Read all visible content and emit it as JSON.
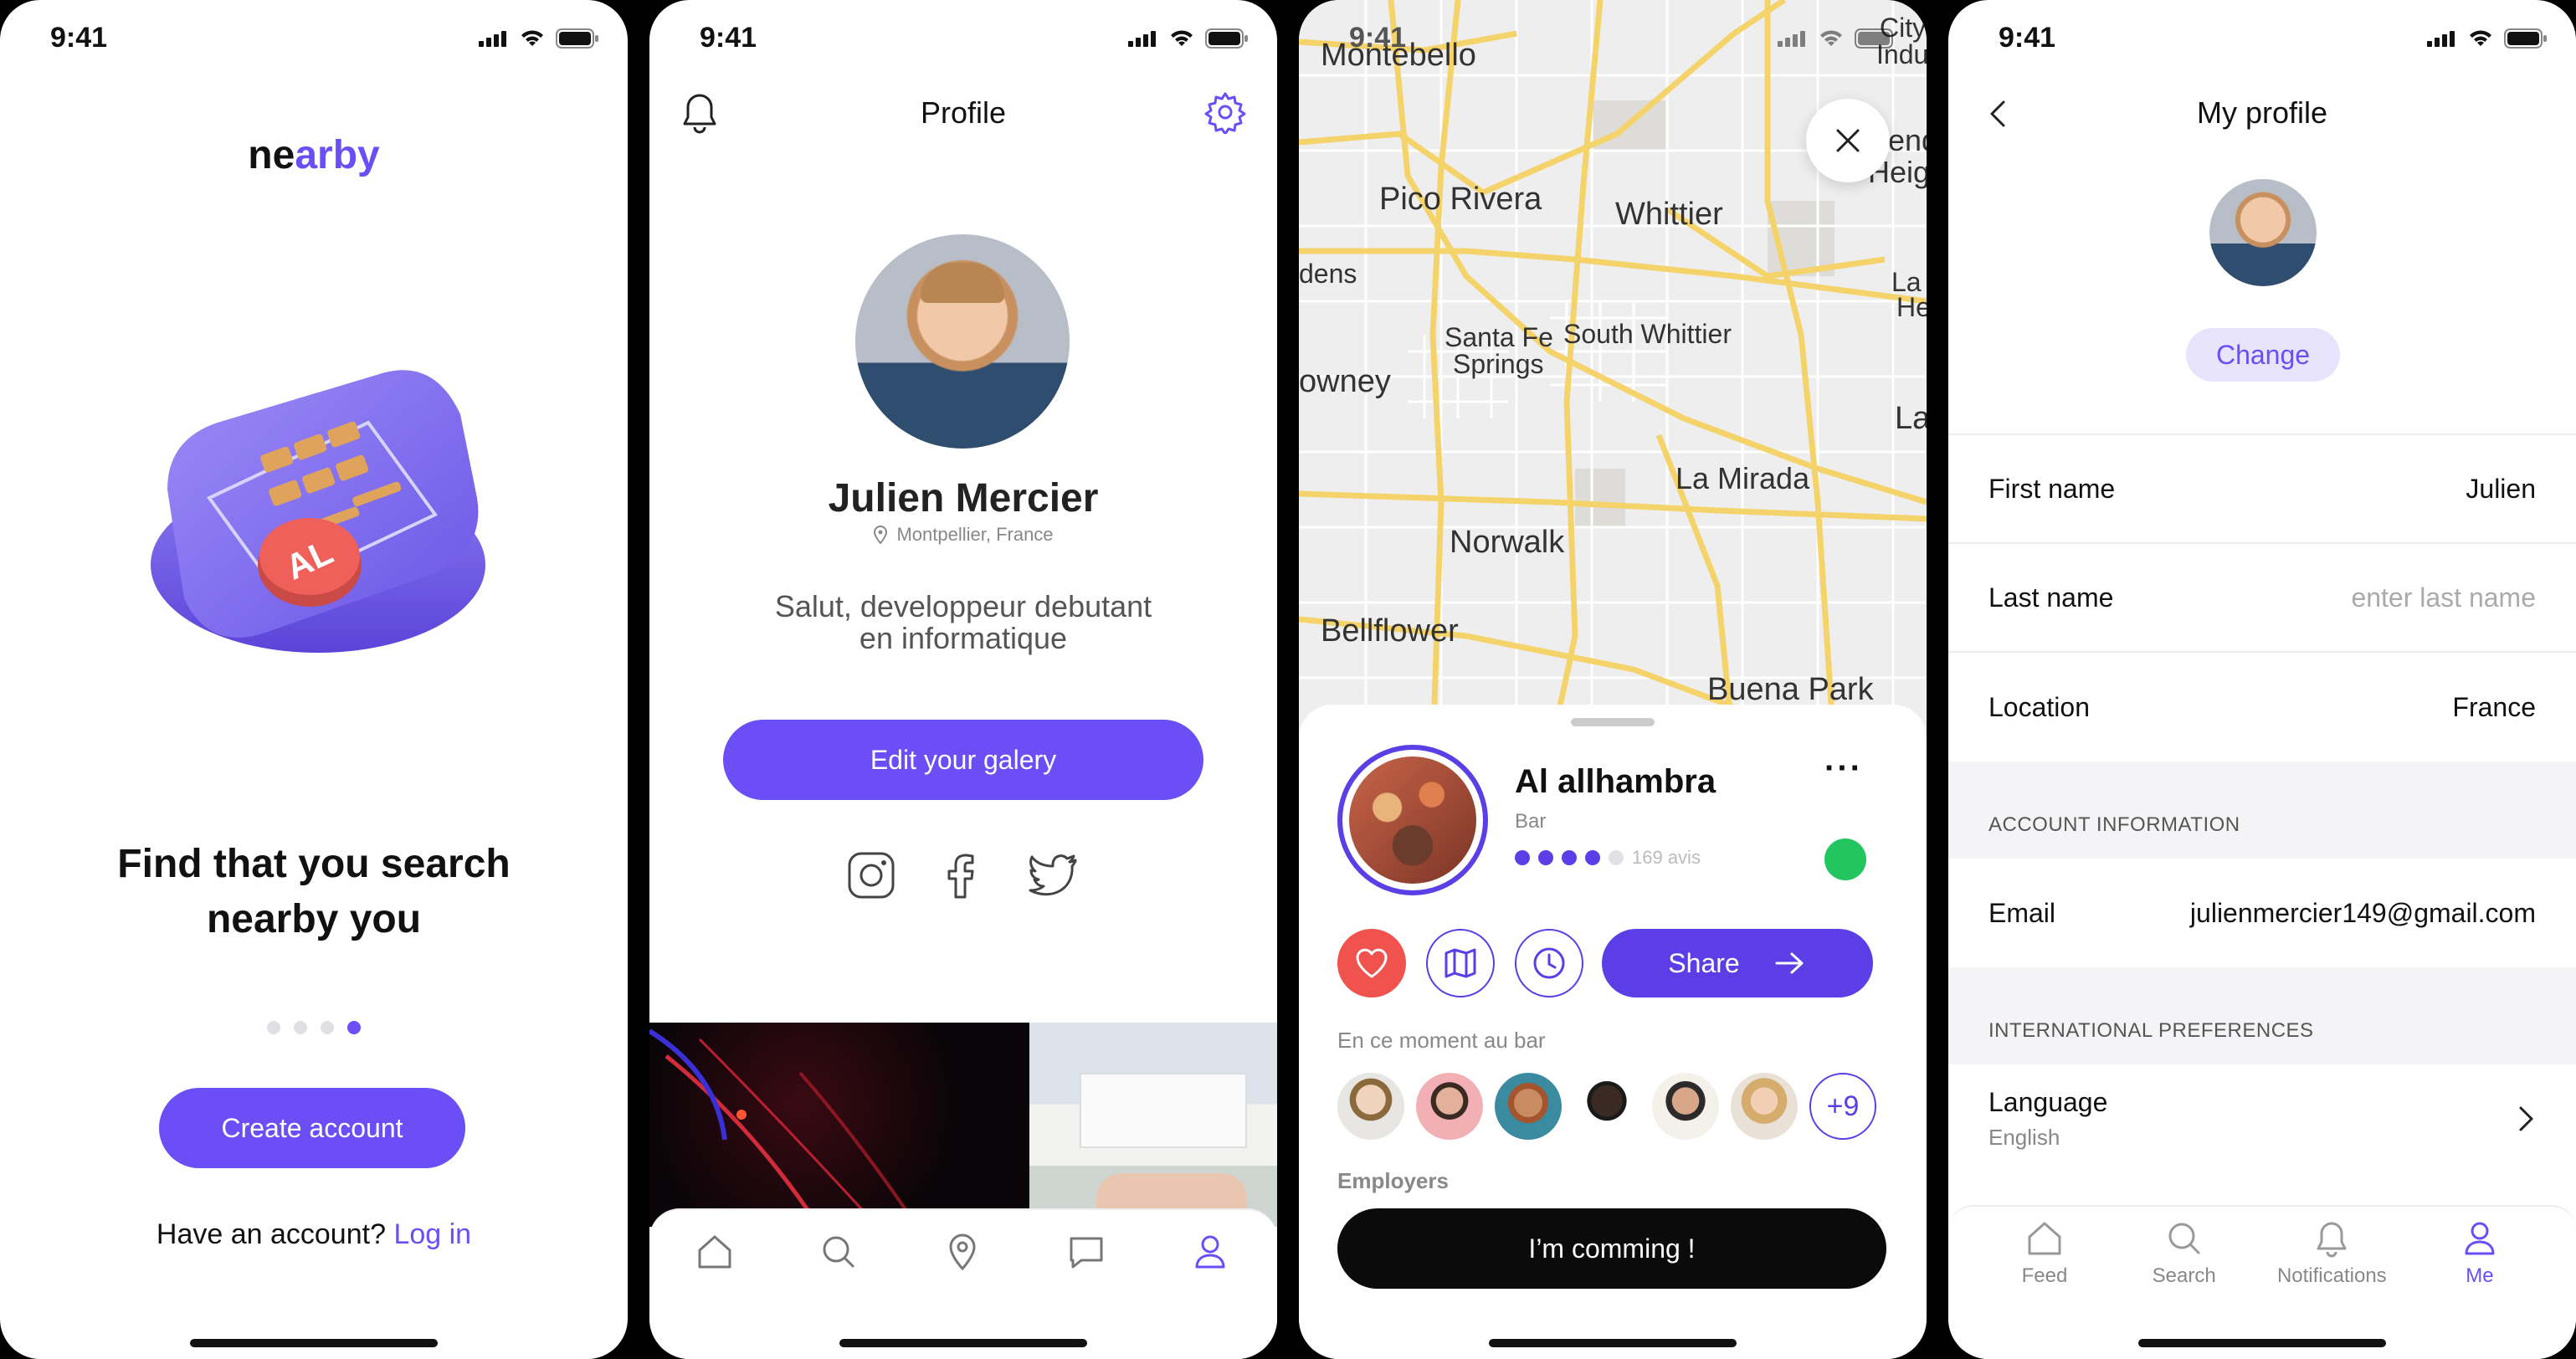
{
  "status": {
    "time": "9:41"
  },
  "onboarding": {
    "logo_part1": "ne",
    "logo_part2": "arby",
    "badge_text": "AL",
    "headline_line1": "Find that you search",
    "headline_line2": "nearby you",
    "pager": {
      "count": 4,
      "active": 4
    },
    "create_account_label": "Create account",
    "have_account_text": "Have an account?",
    "login_label": "Log in"
  },
  "profile": {
    "title": "Profile",
    "name": "Julien Mercier",
    "location": "Montpellier, France",
    "bio_line1": "Salut, developpeur debutant",
    "bio_line2": "en informatique",
    "edit_gallery_label": "Edit your galery",
    "social_icons": [
      "instagram-icon",
      "facebook-icon",
      "twitter-icon"
    ],
    "nav_icons": [
      "home-icon",
      "search-icon",
      "map-pin-icon",
      "chat-icon",
      "user-icon"
    ]
  },
  "map": {
    "labels": [
      "Montebello",
      "Pico Rivera",
      "Whittier",
      "dens",
      "Santa Fe",
      "Springs",
      "South Whittier",
      "owney",
      "La Mirada",
      "Norwalk",
      "Bellflower",
      "Buena Park",
      "City",
      "Indu",
      "end",
      "Height",
      "La",
      "He",
      "La"
    ],
    "venue_name": "Al allhambra",
    "venue_type": "Bar",
    "rating": {
      "value": 4,
      "max": 5
    },
    "reviews": "169 avis",
    "status_color": "#22C55E",
    "more_label": "···",
    "share_label": "Share",
    "now_at_bar_label": "En ce moment au bar",
    "attendees_more": "+9",
    "employers_label": "Employers",
    "coming_label": "I’m comming !"
  },
  "myprofile": {
    "title": "My profile",
    "change_label": "Change",
    "fields": [
      {
        "label": "First name",
        "value": "Julien"
      },
      {
        "label": "Last name",
        "placeholder": "enter last name"
      },
      {
        "label": "Location",
        "value": "France"
      }
    ],
    "account_section": "ACCOUNT INFORMATION",
    "email_label": "Email",
    "email_value": "julienmercier149@gmail.com",
    "intl_section": "INTERNATIONAL PREFERENCES",
    "language_label": "Language",
    "language_value": "English",
    "tabs": [
      {
        "label": "Feed",
        "icon": "home-icon"
      },
      {
        "label": "Search",
        "icon": "search-icon"
      },
      {
        "label": "Notifications",
        "icon": "bell-icon"
      },
      {
        "label": "Me",
        "icon": "user-icon"
      }
    ]
  },
  "colors": {
    "accent": "#6B4EF6",
    "heart": "#F0524D",
    "online": "#22C55E"
  }
}
